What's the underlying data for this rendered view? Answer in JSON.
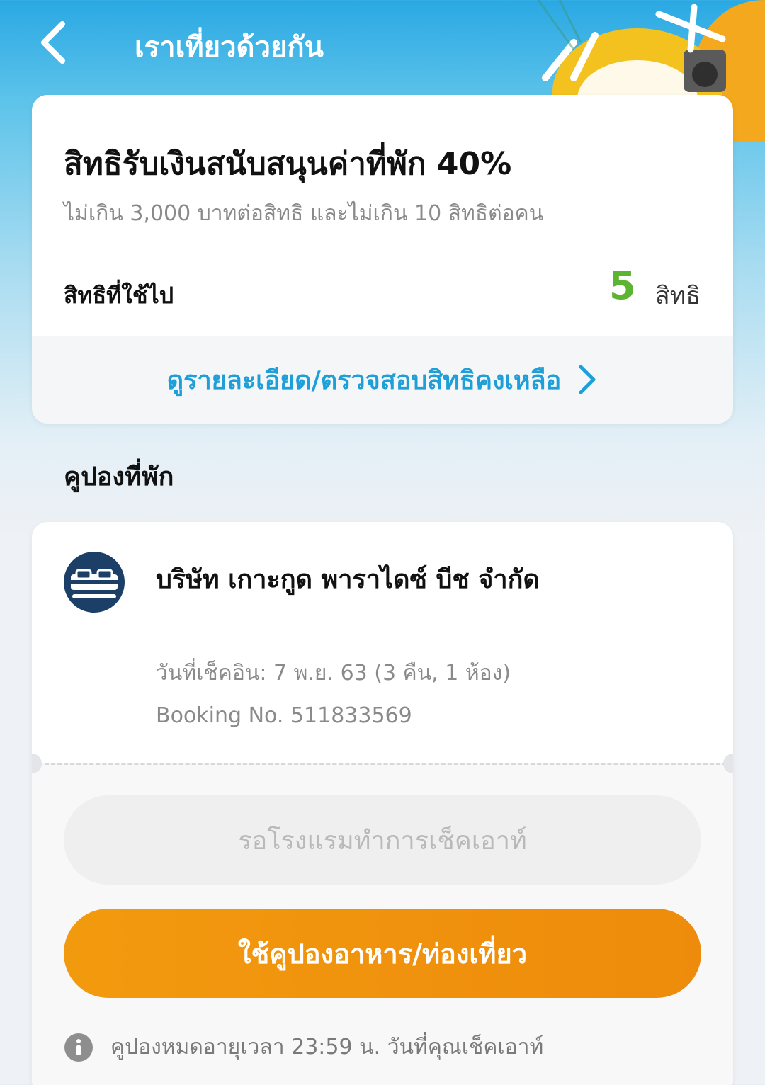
{
  "header": {
    "title": "เราเที่ยวด้วยกัน",
    "back_icon": "chevron-left-icon"
  },
  "entitlement_card": {
    "title": "สิทธิรับเงินสนับสนุนค่าที่พัก 40%",
    "subtitle": "ไม่เกิน 3,000 บาทต่อสิทธิ และไม่เกิน 10 สิทธิต่อคน",
    "used_label": "สิทธิที่ใช้ไป",
    "used_count": "5",
    "used_unit": "สิทธิ",
    "details_link": "ดูรายละเอียด/ตรวจสอบสิทธิคงเหลือ",
    "accent_color": "#1e9fd8",
    "count_color": "#5cb531"
  },
  "section": {
    "title": "คูปองที่พัก"
  },
  "coupon": {
    "hotel_icon": "bed-icon",
    "hotel_name": "บริษัท เกาะกูด พาราไดซ์ บีช จำกัด",
    "checkin": "วันที่เช็คอิน: 7 พ.ย. 63 (3 คืน, 1 ห้อง)",
    "booking": "Booking No. 511833569",
    "wait_button": "รอโรงแรมทำการเช็คเอาท์",
    "use_button": "ใช้คูปองอาหาร/ท่องเที่ยว",
    "use_button_color": "#f0950d",
    "info_icon": "info-icon",
    "info_text": "คูปองหมดอายุเวลา 23:59 น. วันที่คุณเช็คเอาท์"
  }
}
